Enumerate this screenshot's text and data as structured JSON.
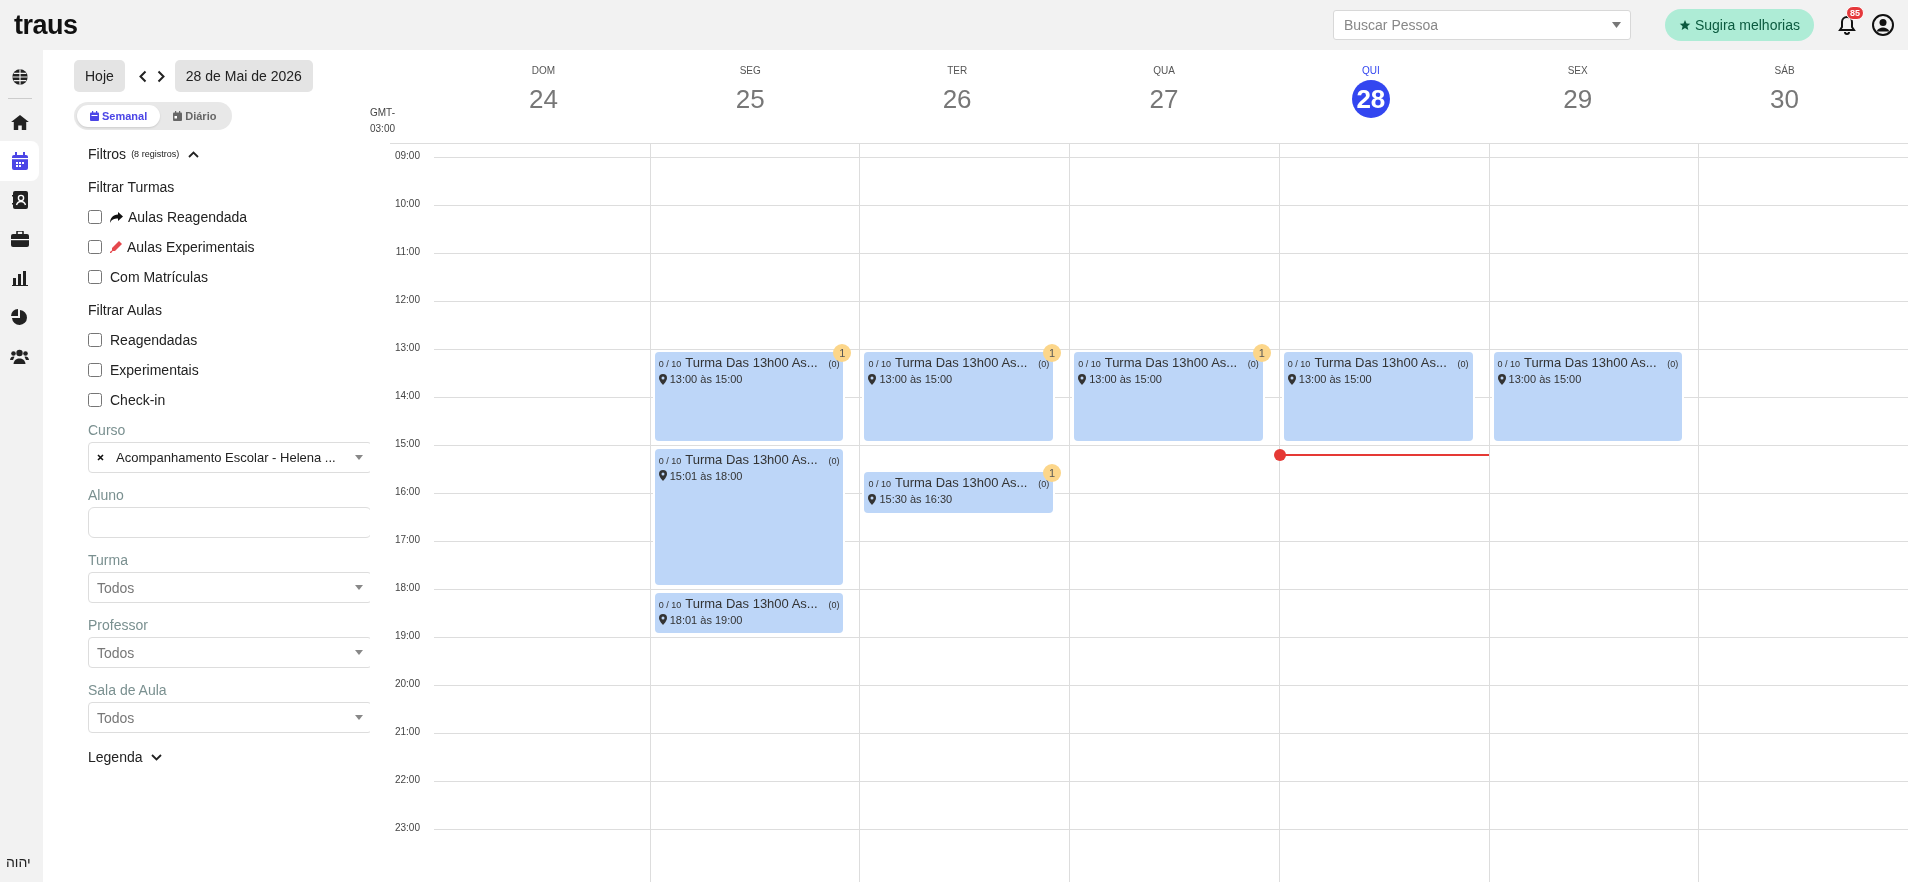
{
  "brand": {
    "logo": "traus"
  },
  "header": {
    "search": {
      "placeholder": "Buscar Pessoa"
    },
    "suggest_button": "Sugira melhorias",
    "notifications": {
      "count": "85"
    }
  },
  "nav_rail": {
    "items": [
      {
        "kind": "globe",
        "selected": false
      },
      {
        "kind": "home",
        "selected": false
      },
      {
        "kind": "calendar",
        "selected": true
      },
      {
        "kind": "contacts",
        "selected": false
      },
      {
        "kind": "briefcase",
        "selected": false
      },
      {
        "kind": "chart",
        "selected": false
      },
      {
        "kind": "pie",
        "selected": false
      },
      {
        "kind": "users",
        "selected": false
      }
    ],
    "footer": "יהוה"
  },
  "toolbar": {
    "today_button": "Hoje",
    "date_button": "28 de Mai de 2026"
  },
  "view_tabs": [
    {
      "label": "Semanal",
      "kind": "week",
      "selected": true
    },
    {
      "label": "Diário",
      "kind": "day",
      "selected": false
    }
  ],
  "filters": {
    "title": "Filtros",
    "count": "(8 registros)",
    "expanded": true,
    "groups": [
      {
        "title": "Filtrar Turmas",
        "options": [
          {
            "label": "Aulas Reagendada",
            "kind": "rescheduled",
            "checked": false
          },
          {
            "label": "Aulas Experimentais",
            "kind": "trial",
            "checked": false
          },
          {
            "label": "Com Matrículas",
            "kind": "plain",
            "checked": false
          }
        ]
      },
      {
        "title": "Filtrar Aulas",
        "options": [
          {
            "label": "Reagendadas",
            "kind": "plain",
            "checked": false
          },
          {
            "label": "Experimentais",
            "kind": "plain",
            "checked": false
          },
          {
            "label": "Check-in",
            "kind": "plain",
            "checked": false
          }
        ]
      }
    ],
    "fields": [
      {
        "label": "Curso",
        "kind": "select",
        "value": "Acompanhamento Escolar - Helena ...",
        "clearable": true
      },
      {
        "label": "Aluno",
        "kind": "input"
      },
      {
        "label": "Turma",
        "kind": "select",
        "placeholder": "Todos",
        "clearable": false
      },
      {
        "label": "Professor",
        "kind": "select",
        "placeholder": "Todos",
        "clearable": false
      },
      {
        "label": "Sala de Aula",
        "kind": "select",
        "placeholder": "Todos",
        "clearable": false
      }
    ],
    "legend": {
      "label": "Legenda",
      "expanded": false
    }
  },
  "calendar": {
    "timezone": "GMT-03:00",
    "hours": [
      "09:00",
      "10:00",
      "11:00",
      "12:00",
      "13:00",
      "14:00",
      "15:00",
      "16:00",
      "17:00",
      "18:00",
      "19:00",
      "20:00",
      "21:00",
      "22:00",
      "23:00"
    ],
    "days": [
      {
        "weekday": "DOM",
        "date": "24",
        "today": false
      },
      {
        "weekday": "SEG",
        "date": "25",
        "today": false,
        "events": [
          {
            "capacity": "0 / 10",
            "title": "Turma Das 13h00 As...",
            "count": "(0)",
            "time": "13:00 às 15:00",
            "badge": "1"
          },
          {
            "capacity": "0 / 10",
            "title": "Turma Das 13h00 As...",
            "count": "(0)",
            "time": "15:01 às 18:00"
          },
          {
            "capacity": "0 / 10",
            "title": "Turma Das 13h00 As...",
            "count": "(0)",
            "time": "18:01 às 19:00"
          }
        ]
      },
      {
        "weekday": "TER",
        "date": "26",
        "today": false,
        "events": [
          {
            "capacity": "0 / 10",
            "title": "Turma Das 13h00 As...",
            "count": "(0)",
            "time": "13:00 às 15:00",
            "badge": "1"
          },
          {
            "capacity": "0 / 10",
            "title": "Turma Das 13h00 As...",
            "count": "(0)",
            "time": "15:30 às 16:30",
            "badge": "1"
          }
        ]
      },
      {
        "weekday": "QUA",
        "date": "27",
        "today": false,
        "events": [
          {
            "capacity": "0 / 10",
            "title": "Turma Das 13h00 As...",
            "count": "(0)",
            "time": "13:00 às 15:00",
            "badge": "1"
          }
        ]
      },
      {
        "weekday": "QUI",
        "date": "28",
        "today": true,
        "events": [
          {
            "capacity": "0 / 10",
            "title": "Turma Das 13h00 As...",
            "count": "(0)",
            "time": "13:00 às 15:00"
          }
        ]
      },
      {
        "weekday": "SEX",
        "date": "29",
        "today": false,
        "events": [
          {
            "capacity": "0 / 10",
            "title": "Turma Das 13h00 As...",
            "count": "(0)",
            "time": "13:00 às 15:00"
          }
        ]
      },
      {
        "weekday": "SÁB",
        "date": "30",
        "today": false
      }
    ]
  }
}
